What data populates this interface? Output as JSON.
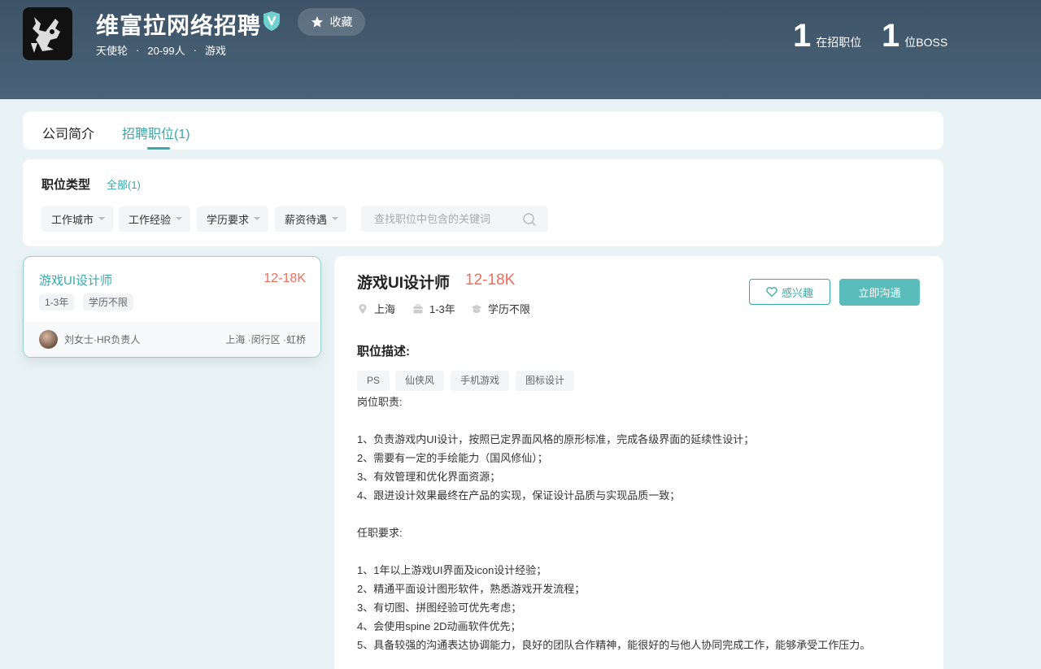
{
  "header": {
    "company_name": "维富拉网络招聘",
    "favorite_label": "收藏",
    "meta": [
      "天使轮",
      "20-99人",
      "游戏"
    ],
    "meta_separator": "·",
    "stats": [
      {
        "num": "1",
        "label": "在招职位"
      },
      {
        "num": "1",
        "label": "位BOSS"
      }
    ]
  },
  "tabs": [
    {
      "label": "公司简介",
      "active": false
    },
    {
      "label": "招聘职位(1)",
      "active": true
    }
  ],
  "filters": {
    "title": "职位类型",
    "all_label": "全部(1)",
    "dropdowns": [
      "工作城市",
      "工作经验",
      "学历要求",
      "薪资待遇"
    ],
    "search_placeholder": "查找职位中包含的关键词"
  },
  "job_list": [
    {
      "title": "游戏UI设计师",
      "salary": "12-18K",
      "tags": [
        "1-3年",
        "学历不限"
      ],
      "recruiter": "刘女士·HR负责人",
      "location": "上海 ·闵行区 ·虹桥"
    }
  ],
  "detail": {
    "title": "游戏UI设计师",
    "salary": "12-18K",
    "city": "上海",
    "experience": "1-3年",
    "education": "学历不限",
    "interest_label": "感兴趣",
    "chat_label": "立即沟通",
    "section_title": "职位描述:",
    "skills": [
      "PS",
      "仙侠风",
      "手机游戏",
      "图标设计"
    ],
    "description": [
      "岗位职责:",
      "",
      "1、负责游戏内UI设计，按照已定界面风格的原形标准，完成各级界面的延续性设计；",
      "2、需要有一定的手绘能力（国风修仙）；",
      "3、有效管理和优化界面资源；",
      "4、跟进设计效果最终在产品的实现，保证设计品质与实现品质一致；",
      "",
      "任职要求:",
      "",
      "1、1年以上游戏UI界面及icon设计经验；",
      "2、精通平面设计图形软件，熟悉游戏开发流程；",
      "3、有切图、拼图经验可优先考虑；",
      "4、会使用spine 2D动画软件优先；",
      "5、具备较强的沟通表达协调能力，良好的团队合作精神，能很好的与他人协同完成工作，能够承受工作压力。"
    ]
  },
  "colors": {
    "accent": "#3aa8a8",
    "salary": "#f26d5b",
    "header_bg": "#3d5367"
  }
}
